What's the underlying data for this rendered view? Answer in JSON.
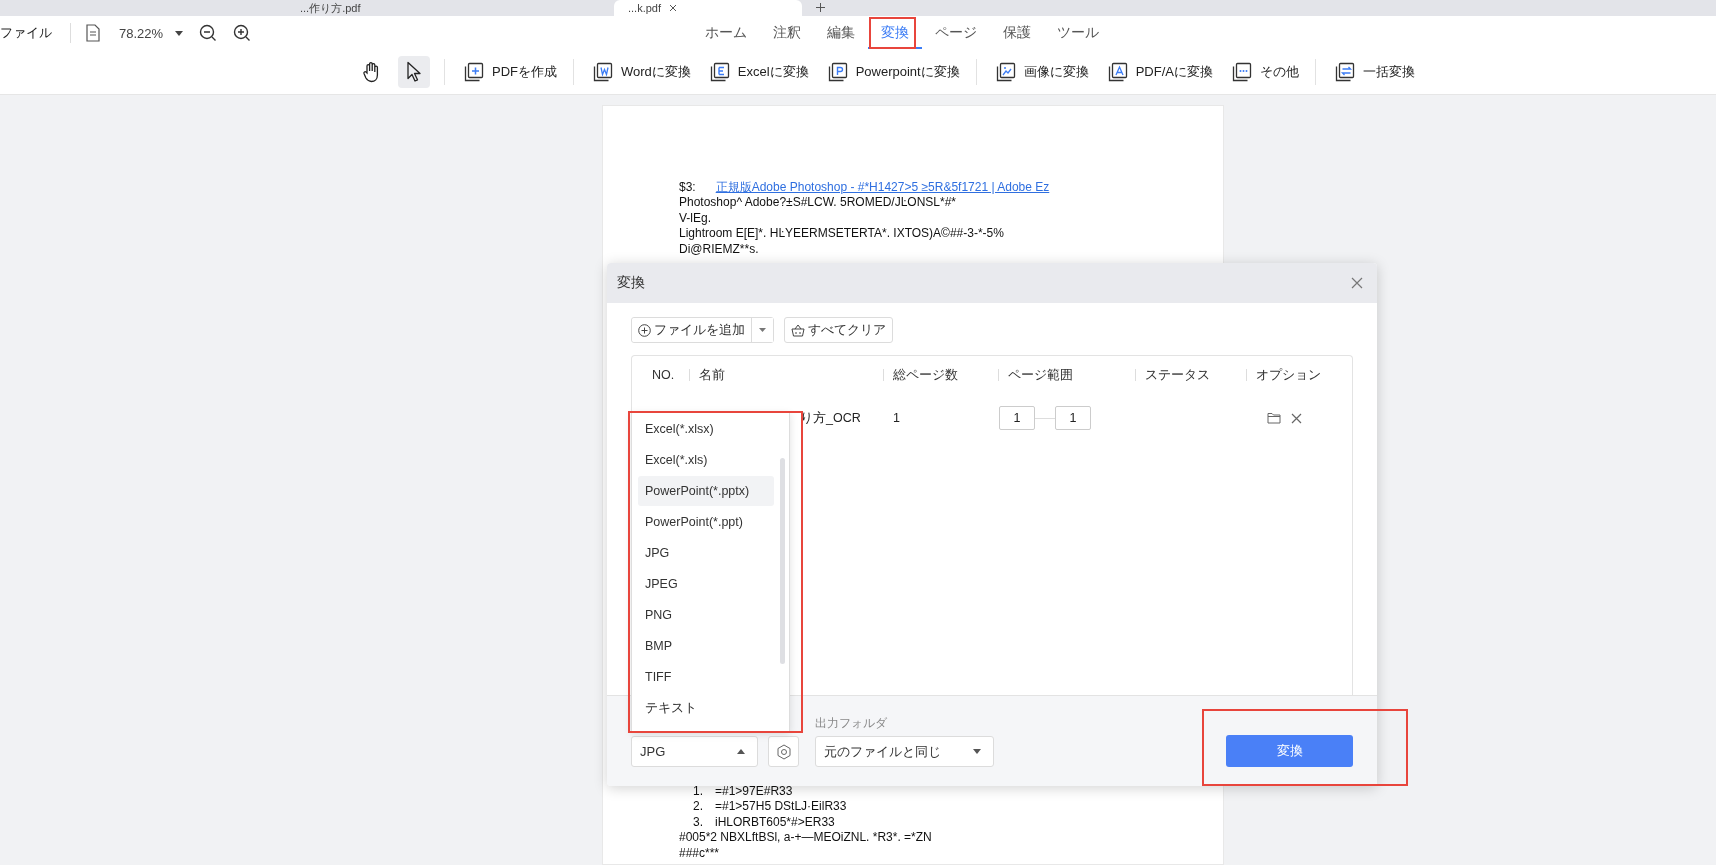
{
  "browser_tabs": [
    {
      "title": "...作り方.pdf",
      "selected": false
    },
    {
      "title": "...k.pdf",
      "selected": true
    }
  ],
  "menu": {
    "file": "ファイル",
    "zoom": "78.22%"
  },
  "ribbon_tabs": [
    {
      "label": "ホーム",
      "selected": false
    },
    {
      "label": "注釈",
      "selected": false
    },
    {
      "label": "編集",
      "selected": false
    },
    {
      "label": "変換",
      "selected": true
    },
    {
      "label": "ページ",
      "selected": false
    },
    {
      "label": "保護",
      "selected": false
    },
    {
      "label": "ツール",
      "selected": false
    }
  ],
  "tools": [
    {
      "kind": "hand",
      "selected": false
    },
    {
      "kind": "pointer",
      "selected": true
    }
  ],
  "toolbar": [
    {
      "kind": "create",
      "label": "PDFを作成"
    },
    {
      "kind": "word",
      "label": "Wordに変換"
    },
    {
      "kind": "excel",
      "label": "Excelに変換"
    },
    {
      "kind": "ppt",
      "label": "Powerpointに変換"
    },
    {
      "kind": "image",
      "label": "画像に変換"
    },
    {
      "kind": "pdfa",
      "label": "PDF/Aに変換"
    },
    {
      "kind": "more",
      "label": "その他"
    },
    {
      "kind": "batch",
      "label": "一括変換"
    }
  ],
  "document": {
    "top_lines": [
      {
        "kind": "link",
        "prefix": "$3:",
        "text": "正規版Adobe Photoshop - #*H1427>5 ≥5R&5f1721 | Adobe Ez"
      },
      {
        "kind": "text",
        "text": "Photoshop^ Adobe?±S#LCW. 5ROMED/JĿONSL*#*"
      },
      {
        "kind": "text",
        "text": "V-lEg."
      },
      {
        "kind": "text",
        "text": "Lightroom E[E]*. HĿYEERMSETERTA*. IXTOS)A©##-3-*-5%"
      },
      {
        "kind": "text",
        "text": "Di@RIEMZ**s."
      }
    ],
    "bottom_lines": [
      {
        "kind": "numbered",
        "number": "1.",
        "text": "=#1>97E#R33"
      },
      {
        "kind": "numbered",
        "number": "2.",
        "text": "=#1>57H5 DStLJ·EilR33"
      },
      {
        "kind": "numbered",
        "number": "3.",
        "text": "iHLORBT605*#>ER33"
      },
      {
        "kind": "text",
        "text": "#005*2 NBXLftBSl, a-+—MEOiZNL. *R3*. =*ZN"
      },
      {
        "kind": "text",
        "text": "###c***"
      }
    ]
  },
  "dialog": {
    "title": "変換",
    "add_button": "ファイルを追加",
    "clear_button": "すべてクリア",
    "columns": [
      "NO.",
      "名前",
      "総ページ数",
      "ページ範囲",
      "ステータス",
      "オプション"
    ],
    "rows": [
      {
        "name": "り方_OCR",
        "pages": "1",
        "from": "1",
        "to": "1"
      }
    ],
    "format_select": "JPG",
    "format_menu": [
      {
        "label": "Excel(*.xlsx)",
        "highlighted": false
      },
      {
        "label": "Excel(*.xls)",
        "highlighted": false
      },
      {
        "label": "PowerPoint(*.pptx)",
        "highlighted": true
      },
      {
        "label": "PowerPoint(*.ppt)",
        "highlighted": false
      },
      {
        "label": "JPG",
        "highlighted": false
      },
      {
        "label": "JPEG",
        "highlighted": false
      },
      {
        "label": "PNG",
        "highlighted": false
      },
      {
        "label": "BMP",
        "highlighted": false
      },
      {
        "label": "TIFF",
        "highlighted": false
      },
      {
        "label": "テキスト",
        "highlighted": false
      }
    ],
    "folder_label": "出力フォルダ",
    "folder_select": "元のファイルと同じ",
    "convert_button": "変換"
  }
}
